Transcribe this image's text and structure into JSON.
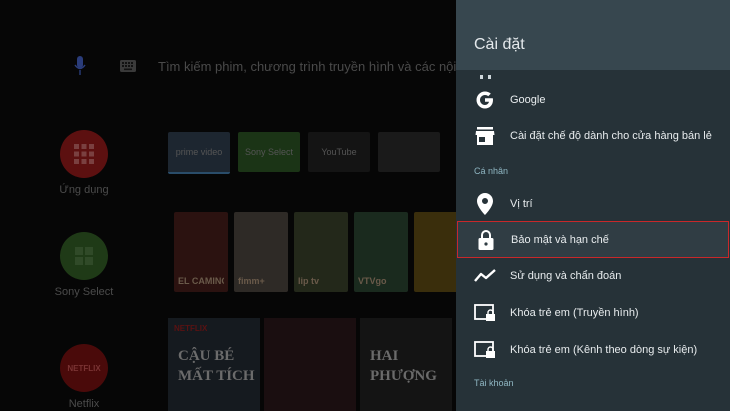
{
  "home": {
    "search_placeholder": "Tìm kiếm phim, chương trình truyền hình và các nội dung",
    "apps": [
      {
        "label": "Ứng dụng"
      },
      {
        "label": "Sony Select"
      },
      {
        "label": "Netflix",
        "logo_text": "NETFLIX"
      }
    ],
    "channels": [
      "prime video",
      "Sony Select",
      "YouTube",
      ""
    ],
    "thumbnails": [
      "EL CAMINO",
      "fimm+",
      "lip tv",
      "VTVgo",
      ""
    ],
    "featured": [
      {
        "brand": "NETFLIX",
        "title": "CẬU BÉ MẤT TÍCH"
      },
      {
        "brand": "",
        "title": ""
      },
      {
        "brand": "",
        "title": "HAI PHƯỢNG"
      },
      {
        "brand": "",
        "title": ""
      }
    ]
  },
  "settings": {
    "title": "Cài đặt",
    "items": [
      {
        "label": "Google",
        "icon": "google-icon"
      },
      {
        "label": "Cài đặt chế độ dành cho cửa hàng bán lẻ",
        "icon": "store-icon"
      },
      {
        "label": "Vị trí",
        "icon": "location-icon"
      },
      {
        "label": "Bảo mật và hạn chế",
        "icon": "lock-icon"
      },
      {
        "label": "Sử dụng và chẩn đoán",
        "icon": "trend-icon"
      },
      {
        "label": "Khóa trẻ em (Truyền hình)",
        "icon": "tv-lock-icon"
      },
      {
        "label": "Khóa trẻ em (Kênh theo dòng sự kiện)",
        "icon": "tv-lock-icon"
      }
    ],
    "sections": {
      "personal": "Cá nhân",
      "account": "Tài khoản"
    }
  },
  "colors": {
    "panel_bg": "#263238",
    "header_bg": "#37474f",
    "highlight_border": "#c8282a",
    "section_text": "#8fb6c2"
  }
}
